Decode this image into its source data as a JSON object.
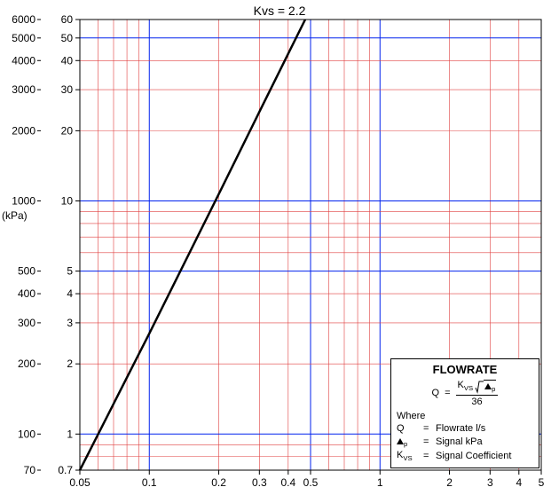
{
  "chart_data": {
    "type": "line",
    "title": "Kvs = 2.2",
    "xlabel": "",
    "ylabel_primary": "",
    "ylabel_secondary_unit": "(kPa)",
    "x_scale": "log",
    "y_scale": "log",
    "xlim": [
      0.05,
      5
    ],
    "ylim_primary": [
      0.7,
      60
    ],
    "ylim_secondary": [
      70,
      6000
    ],
    "x_ticks": [
      0.05,
      0.1,
      0.2,
      0.3,
      0.4,
      0.5,
      1,
      2,
      3,
      4,
      5
    ],
    "x_tick_labels": [
      "0.05",
      "0.1",
      "0.2",
      "0.3",
      "0.4",
      "0.5",
      "1",
      "2",
      "3",
      "4",
      "5"
    ],
    "y_ticks_primary": [
      0.7,
      1,
      2,
      3,
      4,
      5,
      10,
      20,
      30,
      40,
      50,
      60
    ],
    "y_tick_labels_primary": [
      "0.7",
      "1",
      "2",
      "3",
      "4",
      "5",
      "10",
      "20",
      "30",
      "40",
      "50",
      "60"
    ],
    "y_ticks_secondary": [
      70,
      100,
      200,
      300,
      400,
      500,
      1000,
      2000,
      3000,
      4000,
      5000,
      6000
    ],
    "y_tick_labels_secondary": [
      "70",
      "100",
      "200",
      "300",
      "400",
      "500",
      "1000",
      "2000",
      "3000",
      "4000",
      "5000",
      "6000"
    ],
    "series": [
      {
        "name": "Kvs = 2.2",
        "x": [
          0.05,
          0.1,
          0.2,
          0.3,
          0.4,
          0.474
        ],
        "y_primary": [
          0.7,
          2.7,
          10.7,
          24.1,
          42.8,
          60
        ],
        "y_secondary_kPa": [
          70,
          270,
          1070,
          2410,
          4280,
          6000
        ]
      }
    ],
    "legend": {
      "title": "FLOWRATE",
      "formula": {
        "lhs": "Q",
        "rhs_numerator_symbol": "K_vs * sqrt(delta_p)",
        "rhs_denominator": 36
      },
      "where_label": "Where",
      "definitions": [
        {
          "symbol": "Q",
          "meaning": "Flowrate l/s"
        },
        {
          "symbol": "delta_p",
          "meaning": "Signal kPa"
        },
        {
          "symbol": "K_vs",
          "meaning": "Signal Coefficient"
        }
      ]
    }
  },
  "text": {
    "title": "Kvs = 2.2",
    "kpa_unit": "(kPa)",
    "legend_title": "FLOWRATE",
    "Q": "Q",
    "eq": "=",
    "Kvs": "K",
    "vs_sub": "VS",
    "den": "36",
    "where": "Where",
    "q_def": "Flowrate l/s",
    "dp_def": "Signal kPa",
    "kvs_def": "Signal Coefficient",
    "p_sub": "p"
  }
}
